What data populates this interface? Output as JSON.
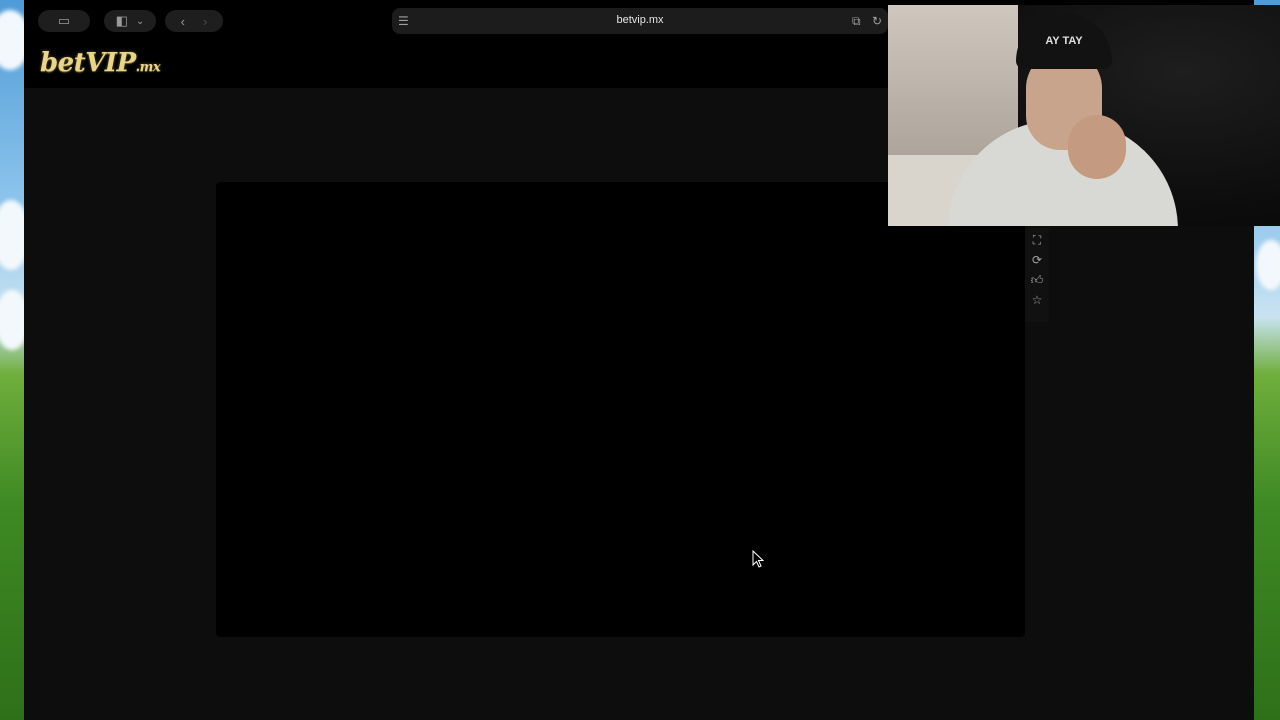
{
  "browser": {
    "url": "betvip.mx",
    "icons": [
      "sidebar-tab-icon",
      "sidebar-toggle-icon",
      "chevron-down-icon",
      "back-icon",
      "forward-icon",
      "reader-icon",
      "translate-icon",
      "reload-icon"
    ]
  },
  "site": {
    "logo_main": "betVIP",
    "logo_suffix": ".mx",
    "side_tools": [
      "fullscreen-icon",
      "refresh-icon",
      "thumbs-up-icon",
      "star-icon"
    ]
  },
  "webcam": {
    "beanie_text": "AY TAY"
  },
  "colors": {
    "window_bg": "#000000",
    "content_bg": "#0d0d0d",
    "logo_gold": "#e8d48a",
    "url_text": "#e6e6e6"
  }
}
